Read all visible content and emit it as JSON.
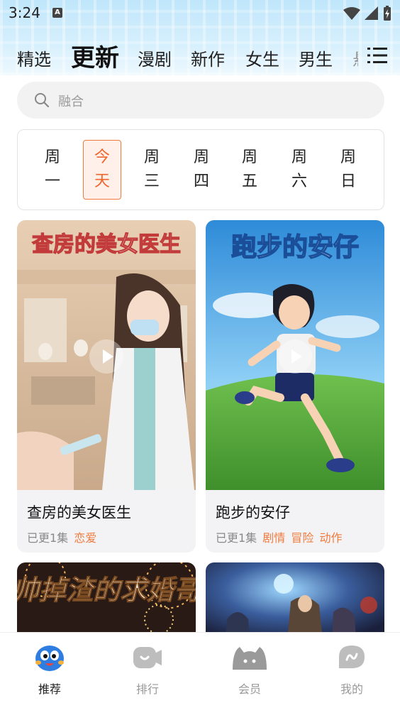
{
  "status_bar": {
    "time": "3:24",
    "badge": "A"
  },
  "tabs": [
    {
      "label": "精选"
    },
    {
      "label": "更新"
    },
    {
      "label": "漫剧"
    },
    {
      "label": "新作"
    },
    {
      "label": "女生"
    },
    {
      "label": "男生"
    },
    {
      "label": "悬"
    }
  ],
  "active_tab": "更新",
  "search": {
    "placeholder": "融合"
  },
  "days": [
    {
      "top": "周",
      "bottom": "一"
    },
    {
      "top": "今",
      "bottom": "天"
    },
    {
      "top": "周",
      "bottom": "三"
    },
    {
      "top": "周",
      "bottom": "四"
    },
    {
      "top": "周",
      "bottom": "五"
    },
    {
      "top": "周",
      "bottom": "六"
    },
    {
      "top": "周",
      "bottom": "日"
    }
  ],
  "active_day": "今天",
  "cards": [
    {
      "poster_text": "查房的美女医生",
      "title": "查房的美女医生",
      "episodes": "已更1集",
      "tags": [
        "恋爱"
      ]
    },
    {
      "poster_text": "跑步的安仔",
      "title": "跑步的安仔",
      "episodes": "已更1集",
      "tags": [
        "剧情",
        "冒险",
        "动作"
      ]
    },
    {
      "poster_text": "帅掉渣的求婚哥"
    },
    {}
  ],
  "bottom_nav": [
    {
      "label": "推荐",
      "icon": "recommend-mascot-icon"
    },
    {
      "label": "排行",
      "icon": "ranking-icon"
    },
    {
      "label": "会员",
      "icon": "member-icon"
    },
    {
      "label": "我的",
      "icon": "profile-icon"
    }
  ],
  "colors": {
    "accent": "#f07a3d",
    "header_bg": "#c9ebfc"
  }
}
